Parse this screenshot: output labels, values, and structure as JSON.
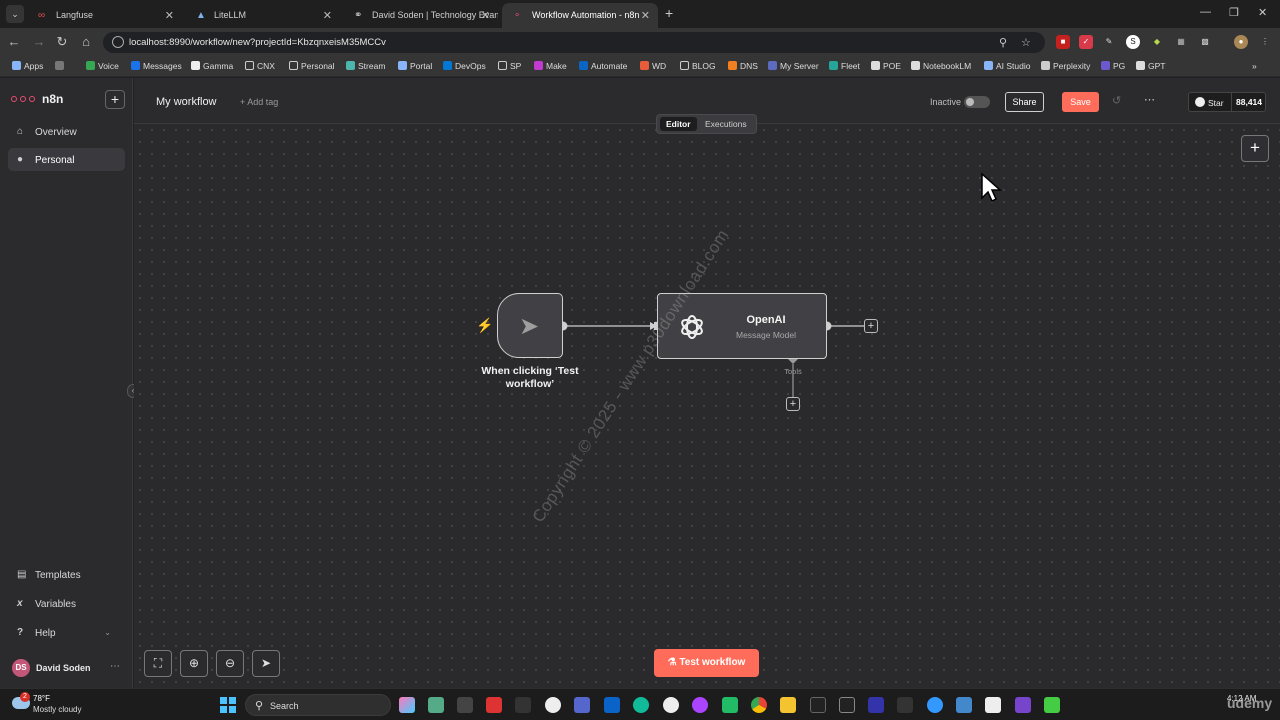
{
  "browser": {
    "tabs": [
      {
        "title": "Langfuse",
        "color": "#e8504b"
      },
      {
        "title": "LiteLLM",
        "color": "#7fb2e8"
      },
      {
        "title": "David Soden | Technology Evan",
        "color": "#cfcfcf"
      },
      {
        "title": "Workflow Automation - n8n",
        "color": "#ea4b71"
      }
    ],
    "url": "localhost:8990/workflow/new?projectId=KbzqnxeisM35MCCv",
    "bookmarks": [
      "Apps",
      "Voice",
      "Messages",
      "Gamma",
      "CNX",
      "Personal",
      "Stream",
      "Portal",
      "DevOps",
      "SP",
      "Make",
      "Automate",
      "WD",
      "BLOG",
      "DNS",
      "My Server",
      "Fleet",
      "POE",
      "NotebookLM",
      "AI Studio",
      "Perplexity",
      "PG",
      "GPT"
    ]
  },
  "sidebar": {
    "brand": "n8n",
    "items": [
      {
        "label": "Overview",
        "icon": "home-icon"
      },
      {
        "label": "Personal",
        "icon": "user-icon"
      }
    ],
    "bottom_items": [
      {
        "label": "Templates",
        "icon": "templates-icon"
      },
      {
        "label": "Variables",
        "icon": "variables-icon"
      },
      {
        "label": "Help",
        "icon": "help-icon"
      }
    ],
    "user": {
      "initials": "DS",
      "name": "David Soden"
    }
  },
  "header": {
    "workflow_name": "My workflow",
    "add_tag": "+ Add tag",
    "status": "Inactive",
    "share": "Share",
    "save": "Save",
    "star_label": "Star",
    "star_count": "88,414"
  },
  "canvas": {
    "modes": [
      "Editor",
      "Executions"
    ],
    "trigger_label": "When clicking ‘Test workflow’",
    "node_title": "OpenAI",
    "node_subtitle": "Message Model",
    "tools_label": "Tools",
    "test_button": "Test workflow",
    "watermark": "Copyright © 2025 - www.p30download.com"
  },
  "taskbar": {
    "temp": "78°F",
    "condition": "Mostly cloudy",
    "weather_badge": "2",
    "search": "Search",
    "time": "4:12 AM",
    "overlay": "udemy"
  },
  "colors": {
    "accent": "#ff6d5a",
    "brand": "#ea4b71"
  }
}
